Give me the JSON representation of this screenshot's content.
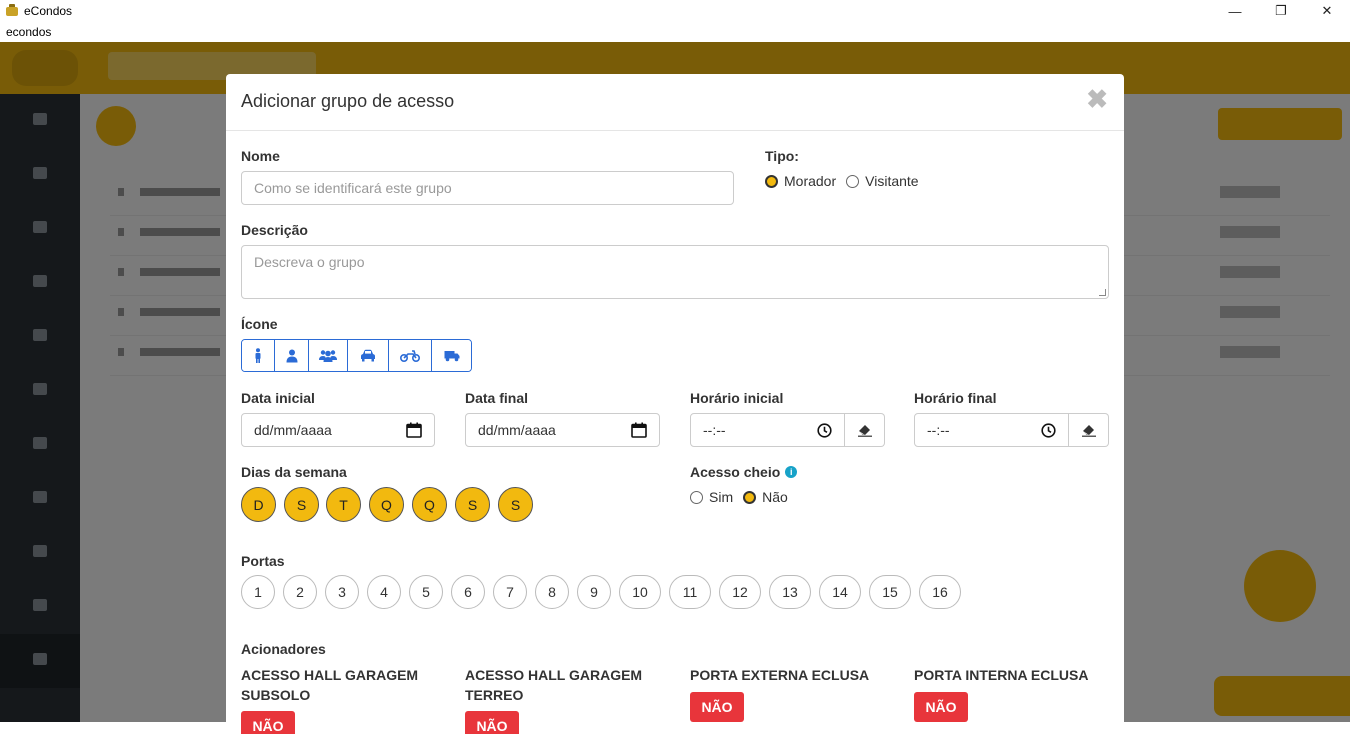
{
  "window": {
    "title": "eCondos",
    "menu_label": "econdos",
    "minimize": "—",
    "maximize": "❐",
    "close": "✕"
  },
  "modal": {
    "title": "Adicionar grupo de acesso",
    "close_symbol": "✖",
    "name_label": "Nome",
    "name_placeholder": "Como se identificará este grupo",
    "type_label": "Tipo:",
    "type_options": [
      "Morador",
      "Visitante"
    ],
    "type_selected": "Morador",
    "description_label": "Descrição",
    "description_placeholder": "Descreva o grupo",
    "icon_label": "Ícone",
    "icons": [
      "person-icon",
      "user-icon",
      "users-icon",
      "car-icon",
      "motorcycle-icon",
      "truck-icon"
    ],
    "start_date_label": "Data inicial",
    "start_date_value": "dd/mm/aaaa",
    "end_date_label": "Data final",
    "end_date_value": "dd/mm/aaaa",
    "start_time_label": "Horário inicial",
    "start_time_value": "--:--",
    "end_time_label": "Horário final",
    "end_time_value": "--:--",
    "weekdays_label": "Dias da semana",
    "weekdays": [
      "D",
      "S",
      "T",
      "Q",
      "Q",
      "S",
      "S"
    ],
    "full_access_label": "Acesso cheio",
    "full_access_options": [
      "Sim",
      "Não"
    ],
    "full_access_selected": "Não",
    "doors_label": "Portas",
    "doors": [
      "1",
      "2",
      "3",
      "4",
      "5",
      "6",
      "7",
      "8",
      "9",
      "10",
      "11",
      "12",
      "13",
      "14",
      "15",
      "16"
    ],
    "actuators_label": "Acionadores",
    "actuators": [
      {
        "name": "ACESSO HALL GARAGEM SUBSOLO",
        "state": "NÃO"
      },
      {
        "name": "ACESSO HALL GARAGEM TERREO",
        "state": "NÃO"
      },
      {
        "name": "PORTA EXTERNA ECLUSA",
        "state": "NÃO"
      },
      {
        "name": "PORTA INTERNA ECLUSA",
        "state": "NÃO"
      }
    ]
  },
  "colors": {
    "accent": "#f2b90f",
    "primary_blue": "#2b6bd6",
    "danger": "#e8353b"
  }
}
